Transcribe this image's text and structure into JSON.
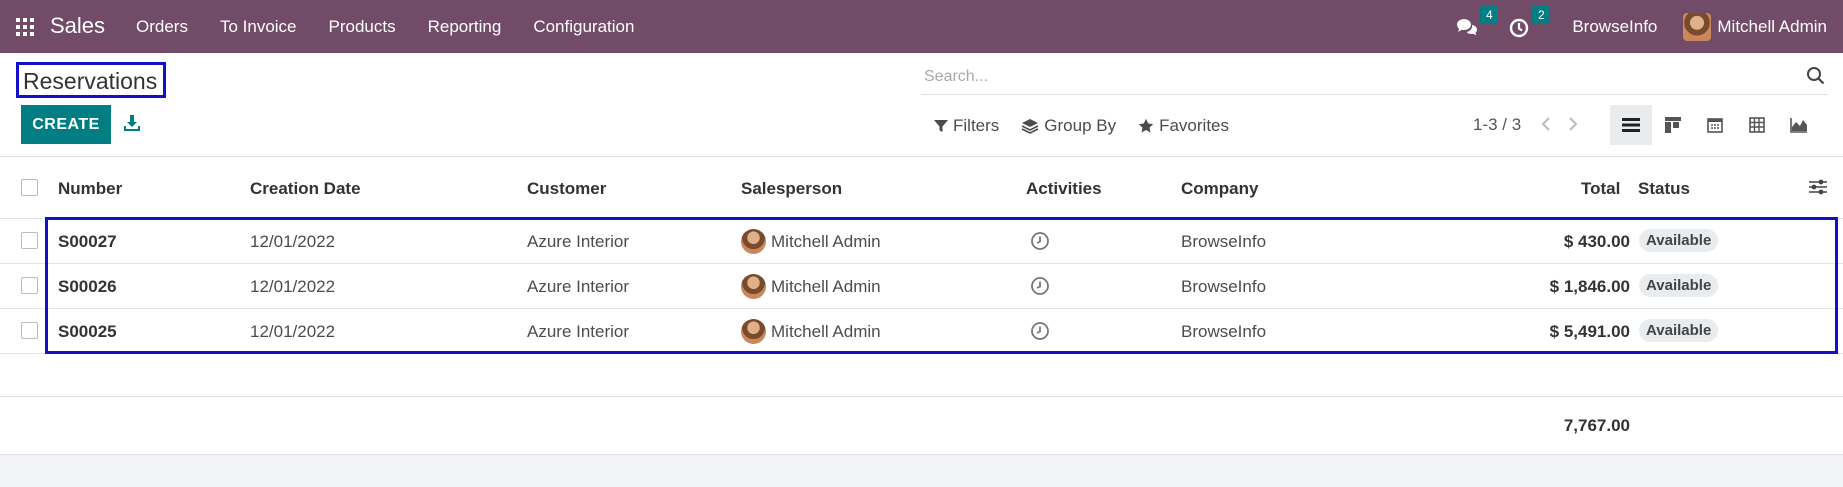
{
  "navbar": {
    "app_name": "Sales",
    "menu": [
      "Orders",
      "To Invoice",
      "Products",
      "Reporting",
      "Configuration"
    ],
    "messages_count": "4",
    "activities_count": "2",
    "company": "BrowseInfo",
    "user": "Mitchell Admin"
  },
  "control_panel": {
    "breadcrumb": "Reservations",
    "search_placeholder": "Search...",
    "create_label": "CREATE",
    "filters_label": "Filters",
    "group_by_label": "Group By",
    "favorites_label": "Favorites",
    "pager": "1-3 / 3"
  },
  "table": {
    "columns": {
      "number": "Number",
      "creation_date": "Creation Date",
      "customer": "Customer",
      "salesperson": "Salesperson",
      "activities": "Activities",
      "company": "Company",
      "total": "Total",
      "status": "Status"
    },
    "rows": [
      {
        "number": "S00027",
        "creation_date": "12/01/2022",
        "customer": "Azure Interior",
        "salesperson": "Mitchell Admin",
        "company": "BrowseInfo",
        "total": "$ 430.00",
        "status": "Available"
      },
      {
        "number": "S00026",
        "creation_date": "12/01/2022",
        "customer": "Azure Interior",
        "salesperson": "Mitchell Admin",
        "company": "BrowseInfo",
        "total": "$ 1,846.00",
        "status": "Available"
      },
      {
        "number": "S00025",
        "creation_date": "12/01/2022",
        "customer": "Azure Interior",
        "salesperson": "Mitchell Admin",
        "company": "BrowseInfo",
        "total": "$ 5,491.00",
        "status": "Available"
      }
    ],
    "sum_total": "7,767.00"
  },
  "colors": {
    "navbar": "#714b67",
    "primary": "#017e84",
    "highlight_box": "#1111cc"
  }
}
